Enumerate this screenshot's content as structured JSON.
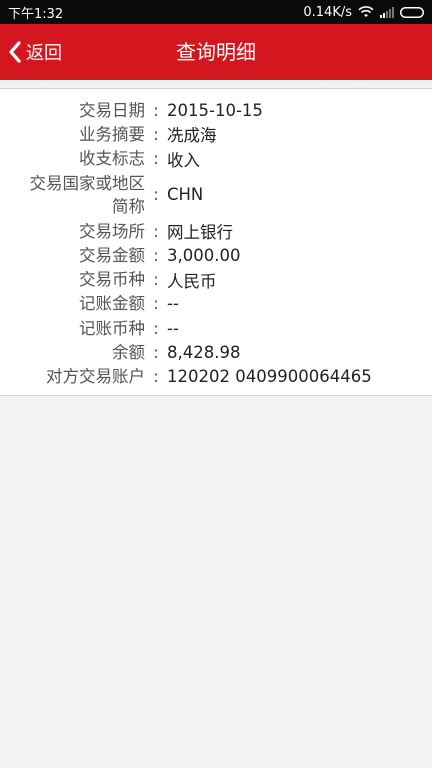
{
  "status_bar": {
    "time": "下午1:32",
    "network_speed": "0.14K/s"
  },
  "nav": {
    "back_label": "返回",
    "title": "查询明细"
  },
  "colors": {
    "nav_background": "#d4171e",
    "status_bar_background": "#0a0a0a"
  },
  "details": {
    "rows": [
      {
        "label": "交易日期",
        "sep": ":",
        "value": "2015-10-15"
      },
      {
        "label": "业务摘要",
        "sep": ":",
        "value": "冼成海"
      },
      {
        "label": "收支标志",
        "sep": ":",
        "value": "收入"
      },
      {
        "label_line1": "交易国家或地区",
        "label_line2": "简称",
        "sep": ":",
        "value": "CHN"
      },
      {
        "label": "交易场所",
        "sep": ":",
        "value": "网上银行"
      },
      {
        "label": "交易金额",
        "sep": ":",
        "value": "3,000.00"
      },
      {
        "label": "交易币种",
        "sep": ":",
        "value": "人民币"
      },
      {
        "label": "记账金额",
        "sep": ":",
        "value": "--"
      },
      {
        "label": "记账币种",
        "sep": ":",
        "value": "--"
      },
      {
        "label": "余额",
        "sep": ":",
        "value": "8,428.98"
      },
      {
        "label": "对方交易账户",
        "sep": ":",
        "value": "120202 0409900064465"
      }
    ]
  }
}
